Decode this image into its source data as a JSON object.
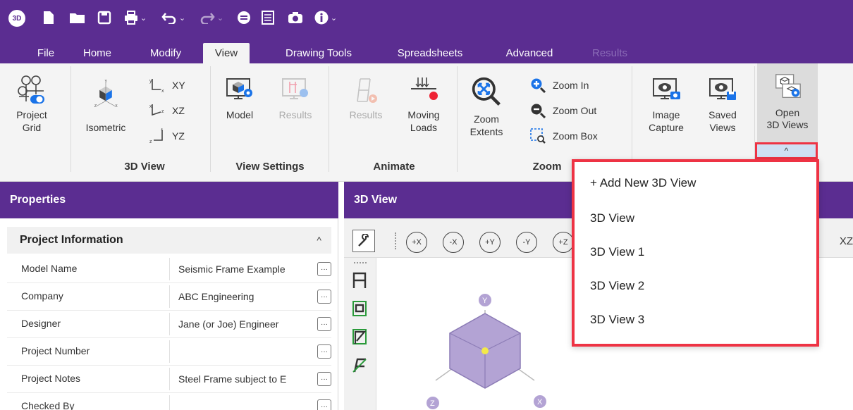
{
  "app": {
    "logo_text": "3D"
  },
  "quick_access": {
    "icons": [
      "new-file-icon",
      "open-folder-icon",
      "save-icon",
      "print-icon",
      "undo-icon",
      "redo-icon",
      "properties-icon",
      "spreadsheet-icon",
      "camera-icon",
      "info-icon"
    ]
  },
  "menu_tabs": [
    {
      "label": "File"
    },
    {
      "label": "Home"
    },
    {
      "label": "Modify"
    },
    {
      "label": "View",
      "active": true
    },
    {
      "label": "Drawing Tools"
    },
    {
      "label": "Spreadsheets"
    },
    {
      "label": "Advanced"
    },
    {
      "label": "Results",
      "disabled": true
    }
  ],
  "ribbon": {
    "project_grid": "Project\nGrid",
    "isometric": "Isometric",
    "xy": "XY",
    "xz": "XZ",
    "yz": "YZ",
    "model": "Model",
    "results_view": "Results",
    "results_animate": "Results",
    "moving_loads": "Moving\nLoads",
    "zoom_extents": "Zoom\nExtents",
    "zoom_in": "Zoom In",
    "zoom_out": "Zoom Out",
    "zoom_box": "Zoom Box",
    "image_capture": "Image\nCapture",
    "saved_views": "Saved\nViews",
    "open_3d_views": "Open\n3D Views",
    "groups": {
      "view3d": "3D View",
      "view_settings": "View Settings",
      "animate": "Animate",
      "zoom": "Zoom"
    },
    "collapse_glyph": "^"
  },
  "properties_panel": {
    "title": "Properties",
    "section": "Project Information",
    "rows": [
      {
        "label": "Model Name",
        "value": "Seismic Frame Example"
      },
      {
        "label": "Company",
        "value": "ABC Engineering"
      },
      {
        "label": "Designer",
        "value": "Jane (or Joe) Engineer"
      },
      {
        "label": "Project Number",
        "value": ""
      },
      {
        "label": "Project Notes",
        "value": "Steel Frame subject to E"
      },
      {
        "label": "Checked By",
        "value": ""
      }
    ],
    "dots": "···"
  },
  "view_panel": {
    "title": "3D View",
    "rotations": [
      "+X",
      "-X",
      "+Y",
      "-Y",
      "+Z"
    ],
    "plane_label": "XZ",
    "axis_labels": {
      "y": "Y",
      "x": "X",
      "z": "Z"
    }
  },
  "dropdown": {
    "items": [
      "+ Add New 3D View",
      "3D View",
      "3D View 1",
      "3D View 2",
      "3D View 3"
    ]
  },
  "colors": {
    "brand": "#5b2d91",
    "highlight": "#ee3344",
    "cube": "#b3a3d4"
  }
}
